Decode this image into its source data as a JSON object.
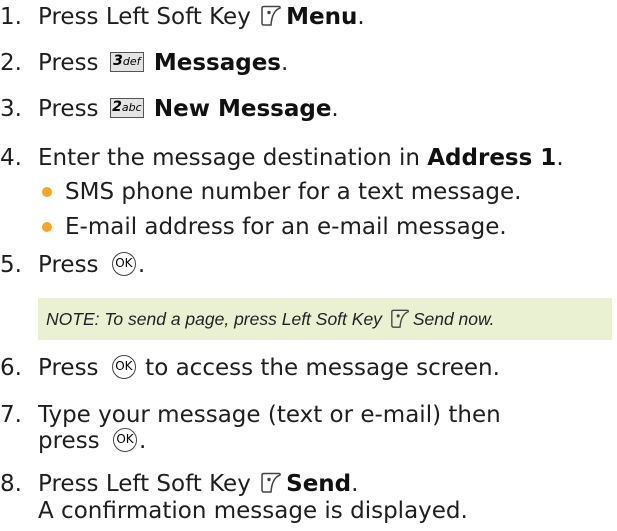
{
  "steps": [
    {
      "num": "1.",
      "pre": "Press Left Soft Key",
      "bold": "Menu",
      "post": "."
    },
    {
      "num": "2.",
      "pre": "Press",
      "key": "3",
      "key_sub": "def",
      "bold": "Messages",
      "post": "."
    },
    {
      "num": "3.",
      "pre": "Press",
      "key": "2",
      "key_sub": "abc",
      "bold": "New Message",
      "post": "."
    },
    {
      "num": "4.",
      "pre": "Enter the message destination in",
      "bold": "Address 1",
      "post": "."
    },
    {
      "num": "5.",
      "pre": "Press",
      "post": "."
    },
    {
      "num": "6.",
      "pre": "Press",
      "post": "to access the message screen."
    },
    {
      "num": "7.",
      "pre": "Type your message (text or e-mail) then",
      "line2_pre": "press",
      "post": "."
    },
    {
      "num": "8.",
      "pre": "Press Left Soft Key",
      "bold": "Send",
      "post": ".",
      "line2": "A confirmation message is displayed."
    }
  ],
  "bullets": [
    "SMS phone number for a text message.",
    "E-mail address for an e-mail message."
  ],
  "note": {
    "pre": "NOTE: To send a page, press Left Soft Key",
    "post": "Send now."
  },
  "ok_label": "OK",
  "colors": {
    "bullet": "#f5a623",
    "note_bg": "#eaf1d3"
  },
  "icons": {
    "soft_key": "left-soft-key-icon",
    "ok": "ok-key-icon"
  }
}
